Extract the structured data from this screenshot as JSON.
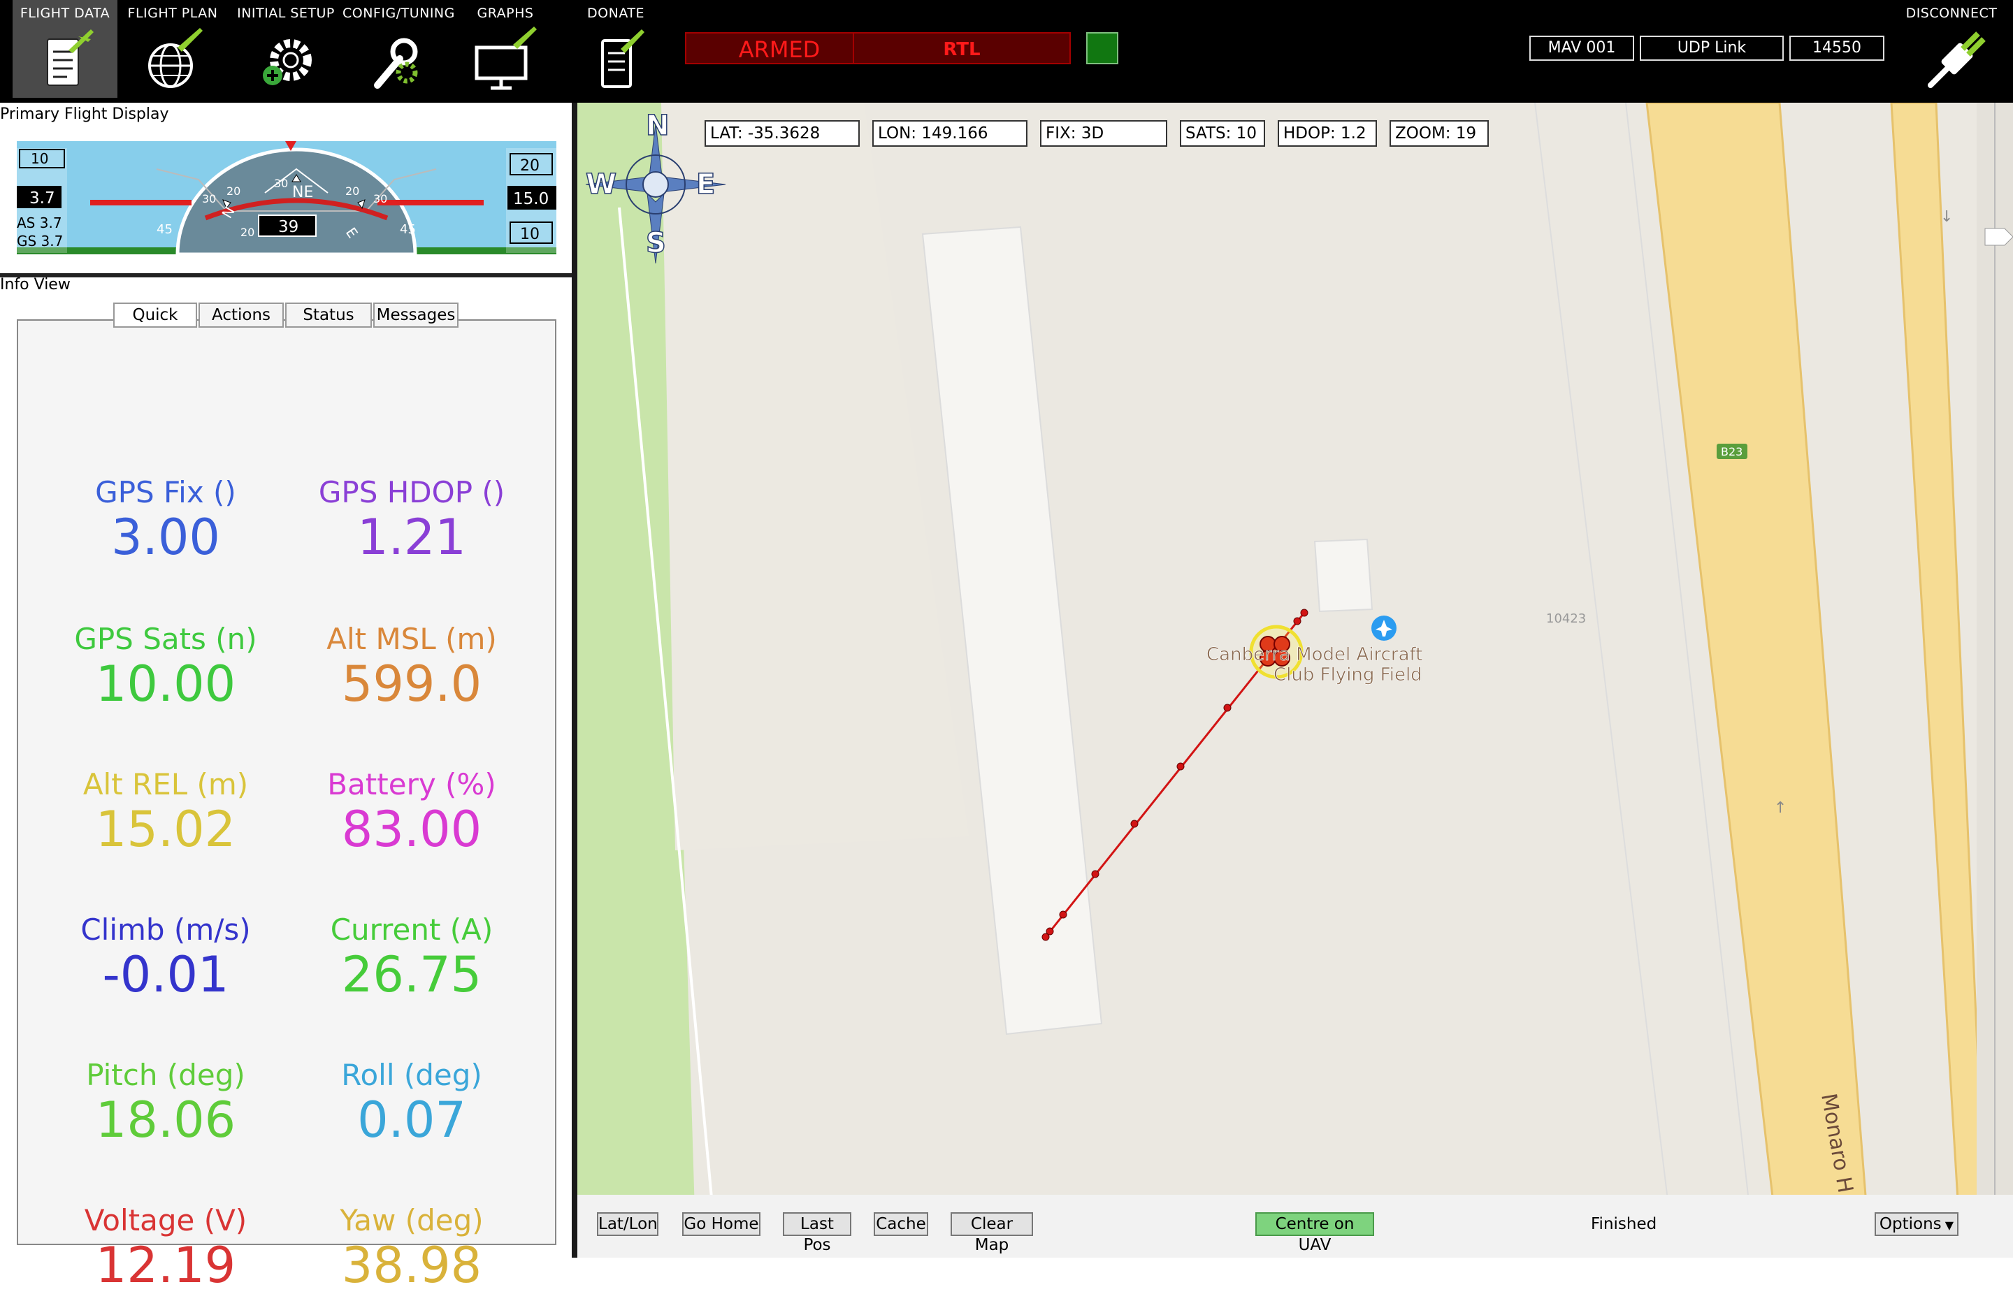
{
  "toolbar": {
    "items": [
      {
        "label": "FLIGHT DATA",
        "icon": "flight-data-icon"
      },
      {
        "label": "FLIGHT PLAN",
        "icon": "flight-plan-icon"
      },
      {
        "label": "INITIAL SETUP",
        "icon": "initial-setup-icon"
      },
      {
        "label": "CONFIG/TUNING",
        "icon": "config-tuning-icon"
      },
      {
        "label": "GRAPHS",
        "icon": "graphs-icon"
      },
      {
        "label": "DONATE",
        "icon": "donate-icon"
      }
    ],
    "armed": "ARMED",
    "mode": "RTL",
    "mav": "MAV 001",
    "link": "UDP Link",
    "port": "14550",
    "disconnect": "DISCONNECT",
    "colors": {
      "alarm": "#ff1a1a",
      "ok": "#117711"
    }
  },
  "pfd": {
    "title": "Primary Flight Display",
    "speed_top": "10",
    "speed": "3.7",
    "as": "AS 3.7",
    "gs": "GS 3.7",
    "alt_top": "20",
    "alt": "15.0",
    "alt_bottom": "10",
    "heading": "39",
    "compass_ne": "NE",
    "compass_n": "N",
    "compass_e": "E",
    "pitch_left": "45",
    "pitch_right": "45",
    "ticks": {
      "l30": "30",
      "l20": "20",
      "c30": "30",
      "r20": "20",
      "r30": "30",
      "b20": "20"
    }
  },
  "info": {
    "title": "Info View",
    "tabs": [
      "Quick",
      "Actions",
      "Status",
      "Messages"
    ],
    "metrics": [
      {
        "label": "GPS Fix ()",
        "value": "3.00",
        "color": "#3a5fd9"
      },
      {
        "label": "GPS HDOP ()",
        "value": "1.21",
        "color": "#8a3fd6"
      },
      {
        "label": "GPS Sats (n)",
        "value": "10.00",
        "color": "#3ec93e"
      },
      {
        "label": "Alt MSL (m)",
        "value": "599.0",
        "color": "#d9873a"
      },
      {
        "label": "Alt REL (m)",
        "value": "15.02",
        "color": "#d9c43a"
      },
      {
        "label": "Battery (%)",
        "value": "83.00",
        "color": "#d93ad2"
      },
      {
        "label": "Climb (m/s)",
        "value": "-0.01",
        "color": "#3434cc"
      },
      {
        "label": "Current (A)",
        "value": "26.75",
        "color": "#46cc3a"
      },
      {
        "label": "Pitch (deg)",
        "value": "18.06",
        "color": "#5fcc3a"
      },
      {
        "label": "Roll (deg)",
        "value": "0.07",
        "color": "#3aa6d9"
      },
      {
        "label": "Voltage (V)",
        "value": "12.19",
        "color": "#d93434"
      },
      {
        "label": "Yaw (deg)",
        "value": "38.98",
        "color": "#d9b23a"
      }
    ]
  },
  "map": {
    "fields": {
      "lat": "LAT: -35.3628",
      "lon": "LON: 149.166",
      "fix": "FIX: 3D",
      "sats": "SATS: 10",
      "hdop": "HDOP: 1.2",
      "zoom": "ZOOM: 19"
    },
    "compass": {
      "n": "N",
      "s": "S",
      "e": "E",
      "w": "W"
    },
    "place_line1": "Canberra Model Aircraft",
    "place_line2": "Club Flying Field",
    "road_shield": "B23",
    "road_number": "10423",
    "road_name": "Monaro H",
    "buttons": {
      "latlon": "Lat/Lon",
      "home": "Go Home",
      "lastpos": "Last Pos",
      "cache": "Cache",
      "clear": "Clear Map",
      "centre": "Centre on UAV",
      "options": "Options"
    },
    "status": "Finished"
  }
}
